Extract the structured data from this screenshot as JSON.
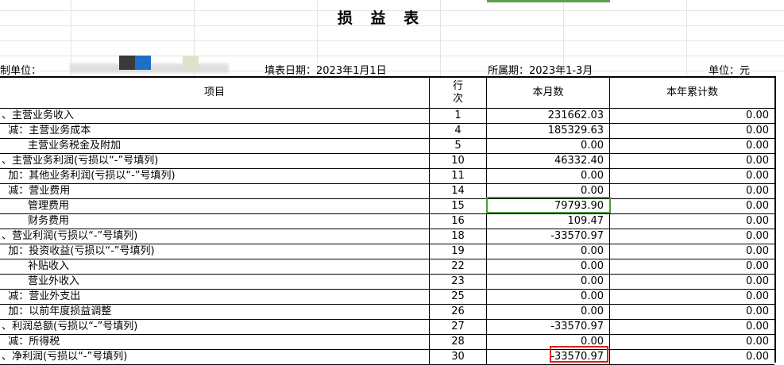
{
  "sheet": {
    "title": "损 益 表",
    "unit_prefix": "制单位：",
    "fill_date_label": "填表日期：2023年1月1日",
    "period_label": "所属期：2023年1-3月",
    "currency_label": "单位：元",
    "swatch_colors": [
      "#3a3a3a",
      "#1d6fc8",
      "#e2e0c6"
    ]
  },
  "table": {
    "headers": {
      "name": "项目",
      "line": "行\n次",
      "month": "本月数",
      "year": "本年累计数"
    },
    "rows": [
      {
        "name": "、主营业务收入",
        "line": "1",
        "month": "231662.03",
        "year": "0.00"
      },
      {
        "name": "  减：主营业务成本",
        "line": "4",
        "month": "185329.63",
        "year": "0.00"
      },
      {
        "name": "        主营业务税金及附加",
        "line": "5",
        "month": "0.00",
        "year": "0.00"
      },
      {
        "name": "、主营业务利润(亏损以“-”号填列)",
        "line": "10",
        "month": "46332.40",
        "year": "0.00"
      },
      {
        "name": "  加：其他业务利润(亏损以“-”号填列)",
        "line": "11",
        "month": "0.00",
        "year": "0.00"
      },
      {
        "name": "  减：营业费用",
        "line": "14",
        "month": "0.00",
        "year": "0.00"
      },
      {
        "name": "        管理费用",
        "line": "15",
        "month": "79793.90",
        "year": "0.00"
      },
      {
        "name": "        财务费用",
        "line": "16",
        "month": "109.47",
        "year": "0.00"
      },
      {
        "name": "、营业利润(亏损以“-”号填列)",
        "line": "18",
        "month": "-33570.97",
        "year": "0.00"
      },
      {
        "name": "  加：投资收益(亏损以“-”号填列)",
        "line": "19",
        "month": "0.00",
        "year": "0.00"
      },
      {
        "name": "        补贴收入",
        "line": "22",
        "month": "0.00",
        "year": "0.00"
      },
      {
        "name": "        营业外收入",
        "line": "23",
        "month": "0.00",
        "year": "0.00"
      },
      {
        "name": "  减：营业外支出",
        "line": "25",
        "month": "0.00",
        "year": "0.00"
      },
      {
        "name": "  加：以前年度损益调整",
        "line": "26",
        "month": "0.00",
        "year": "0.00"
      },
      {
        "name": "、利润总额(亏损以“-”号填列)",
        "line": "27",
        "month": "-33570.97",
        "year": "0.00"
      },
      {
        "name": "  减：所得税",
        "line": "28",
        "month": "0.00",
        "year": "0.00"
      },
      {
        "name": "、净利润(亏损以“-”号填列)",
        "line": "30",
        "month": "-33570.97",
        "year": "0.00"
      }
    ]
  }
}
